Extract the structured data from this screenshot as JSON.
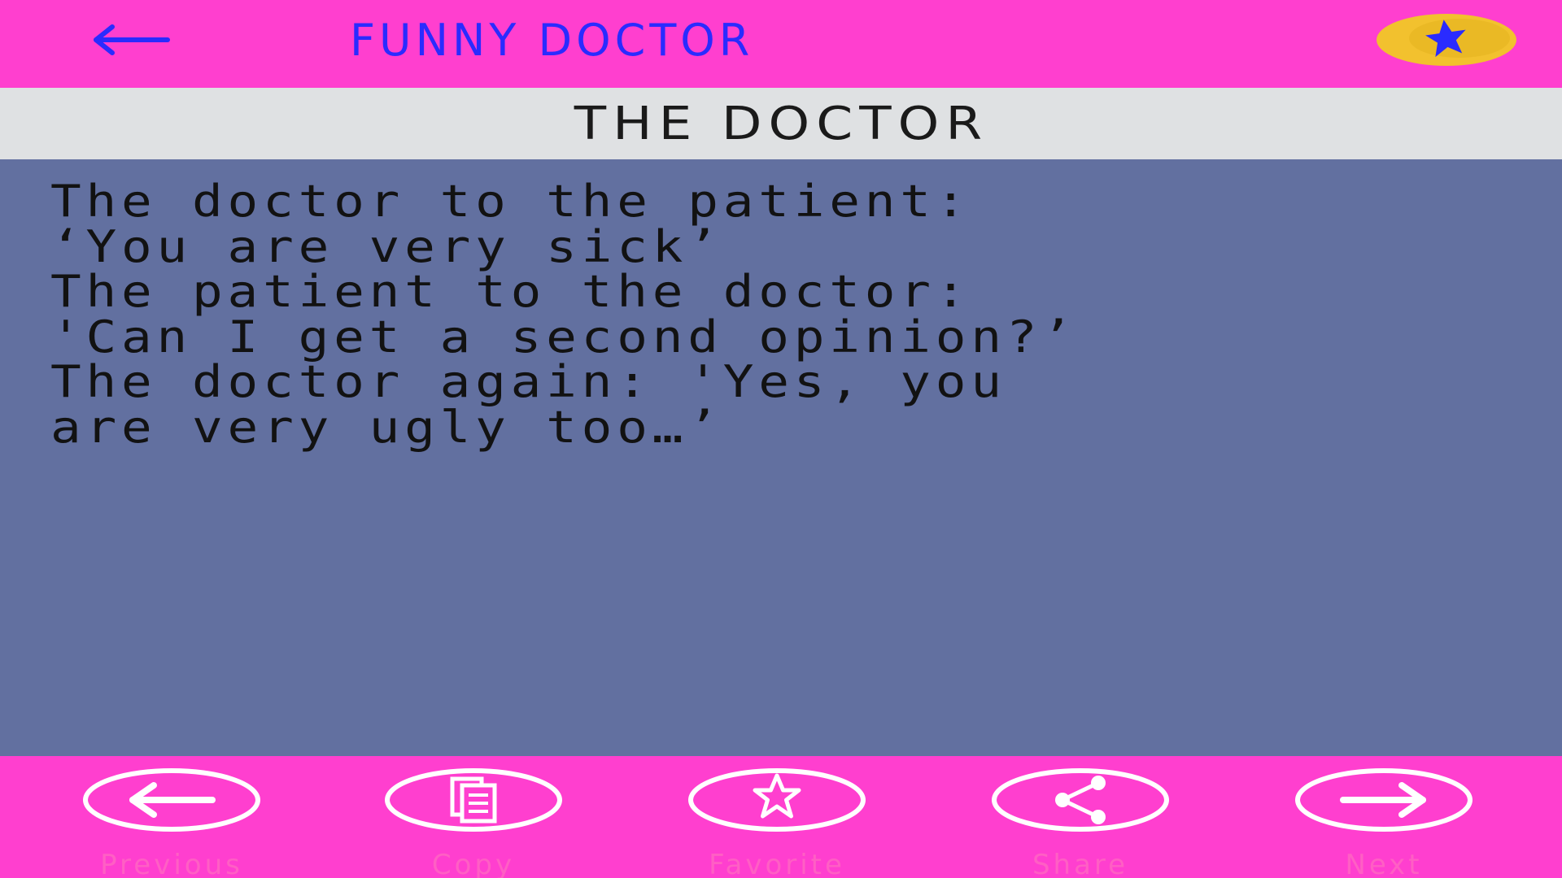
{
  "header": {
    "title": "FUNNY DOCTOR",
    "back_icon": "arrow-left-icon",
    "rate_icon": "star-badge-icon"
  },
  "joke": {
    "title": "THE DOCTOR",
    "lines": [
      "The doctor to the patient:",
      "‘You are very sick’",
      "The patient to the doctor:",
      "'Can I get a second opinion?’",
      "The doctor again: 'Yes, you",
      "are very ugly too…’"
    ]
  },
  "actions": [
    {
      "label": "Previous",
      "icon": "arrow-left-icon"
    },
    {
      "label": "Copy",
      "icon": "copy-icon"
    },
    {
      "label": "Favorite",
      "icon": "star-icon"
    },
    {
      "label": "Share",
      "icon": "share-icon"
    },
    {
      "label": "Next",
      "icon": "arrow-right-icon"
    }
  ],
  "colors": {
    "bar": "#ff3fcf",
    "title_text": "#2a2bff",
    "subheader_bg": "#dfe1e3",
    "content_bg": "#6270a0",
    "badge_yellow": "#f2c12e",
    "action_label": "#ff5fc4"
  }
}
